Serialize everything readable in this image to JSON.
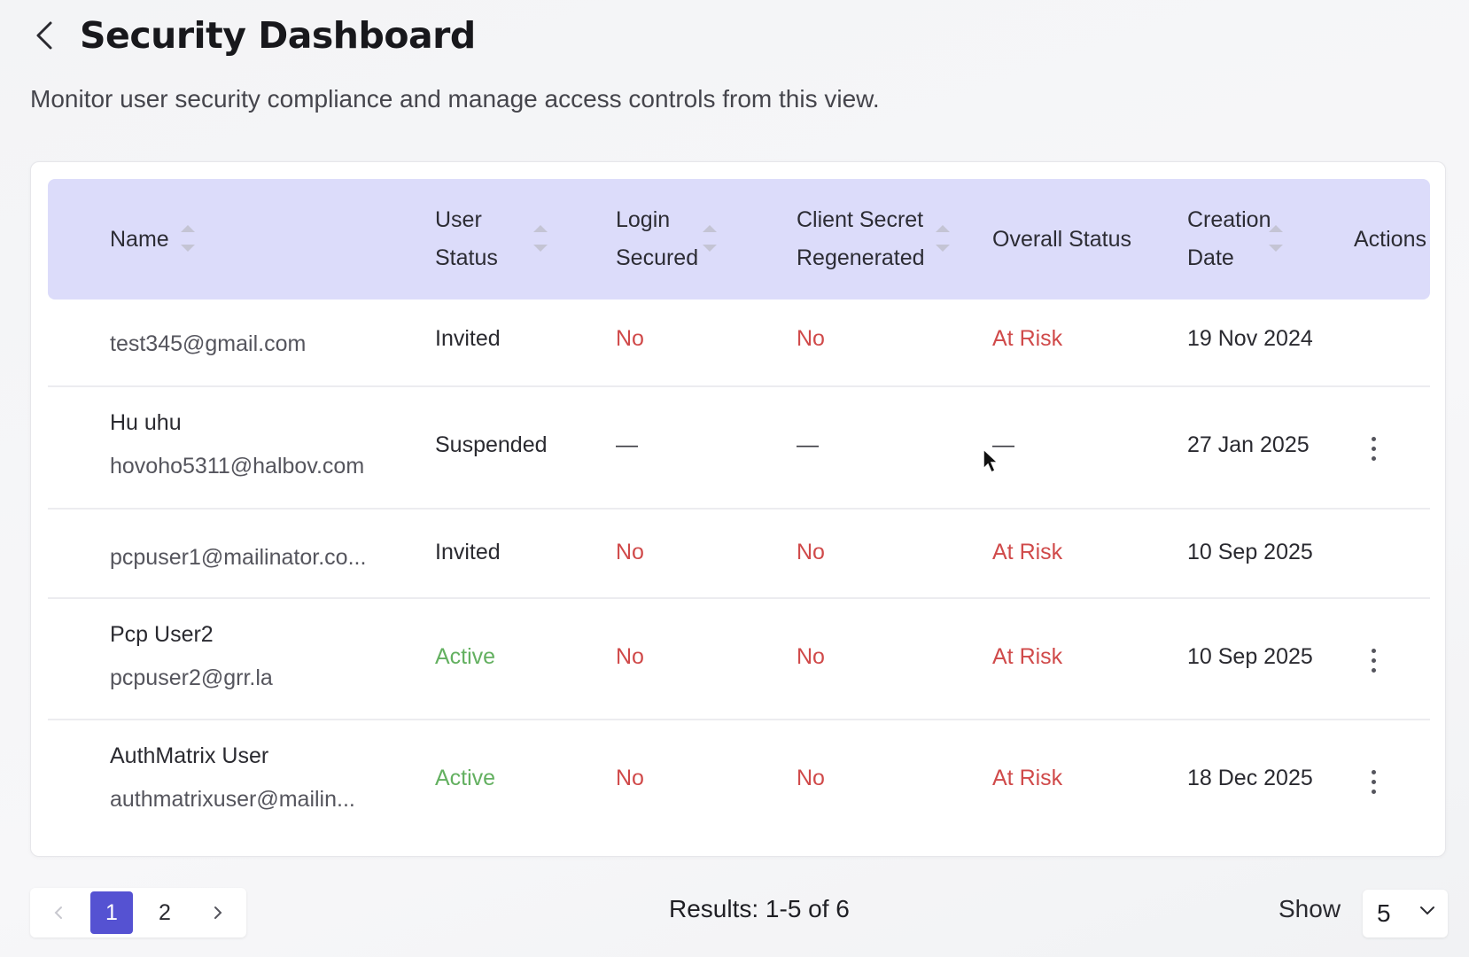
{
  "header": {
    "back_icon": "chevron-left-icon",
    "title": "Security Dashboard",
    "subtitle": "Monitor user security compliance and manage access controls from this view."
  },
  "table": {
    "columns": {
      "name": "Name",
      "user_status_1": "User",
      "user_status_2": "Status",
      "login_secured_1": "Login",
      "login_secured_2": "Secured",
      "client_secret_1": "Client Secret",
      "client_secret_2": "Regenerated",
      "overall_status": "Overall Status",
      "creation_date_1": "Creation",
      "creation_date_2": "Date",
      "actions": "Actions"
    },
    "rows": [
      {
        "name": "",
        "email": "test345@gmail.com",
        "user_status": "Invited",
        "login_secured": "No",
        "client_secret": "No",
        "overall_status": "At Risk",
        "creation_date": "19 Nov 2024",
        "has_actions": false
      },
      {
        "name": "Hu uhu",
        "email": "hovoho5311@halbov.com",
        "user_status": "Suspended",
        "login_secured": "—",
        "client_secret": "—",
        "overall_status": "—",
        "creation_date": "27 Jan 2025",
        "has_actions": true
      },
      {
        "name": "",
        "email": "pcpuser1@mailinator.co...",
        "user_status": "Invited",
        "login_secured": "No",
        "client_secret": "No",
        "overall_status": "At Risk",
        "creation_date": "10 Sep 2025",
        "has_actions": false
      },
      {
        "name": "Pcp User2",
        "email": "pcpuser2@grr.la",
        "user_status": "Active",
        "login_secured": "No",
        "client_secret": "No",
        "overall_status": "At Risk",
        "creation_date": "10 Sep 2025",
        "has_actions": true
      },
      {
        "name": "AuthMatrix User",
        "email": "authmatrixuser@mailin...",
        "user_status": "Active",
        "login_secured": "No",
        "client_secret": "No",
        "overall_status": "At Risk",
        "creation_date": "18 Dec 2025",
        "has_actions": true
      }
    ]
  },
  "pagination": {
    "prev_icon": "chevron-left-icon",
    "next_icon": "chevron-right-icon",
    "pages": [
      "1",
      "2"
    ],
    "current_page": "1",
    "results_text": "Results: 1-5 of 6",
    "show_label": "Show",
    "page_size": "5"
  },
  "colors": {
    "header_bg": "#dcdcfa",
    "accent": "#5552d2",
    "risk_red": "#d04a4a",
    "active_green": "#63b060"
  }
}
